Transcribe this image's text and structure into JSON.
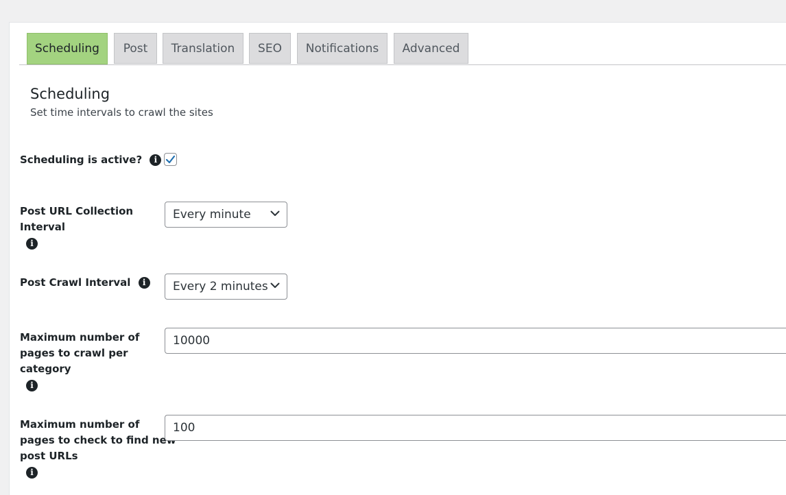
{
  "tabs": [
    {
      "label": "Scheduling",
      "active": true
    },
    {
      "label": "Post",
      "active": false
    },
    {
      "label": "Translation",
      "active": false
    },
    {
      "label": "SEO",
      "active": false
    },
    {
      "label": "Notifications",
      "active": false
    },
    {
      "label": "Advanced",
      "active": false
    }
  ],
  "section": {
    "title": "Scheduling",
    "description": "Set time intervals to crawl the sites"
  },
  "fields": {
    "scheduling_active": {
      "label": "Scheduling is active?",
      "checked": true,
      "icon": "info-icon"
    },
    "url_collection_interval": {
      "label_line1": "Post URL Collection",
      "label_line2": "Interval",
      "value": "Every minute",
      "icon": "info-icon"
    },
    "crawl_interval": {
      "label": "Post Crawl Interval",
      "value": "Every 2 minutes",
      "icon": "info-icon"
    },
    "max_pages_category": {
      "label_line1": "Maximum number of",
      "label_line2": "pages to crawl per",
      "label_line3": "category",
      "value": "10000",
      "icon": "info-icon"
    },
    "max_pages_new_urls": {
      "label_line1": "Maximum number of",
      "label_line2": "pages to check to find new",
      "label_line3": "post URLs",
      "value": "100",
      "icon": "info-icon"
    }
  },
  "colors": {
    "active_tab": "#a3d380",
    "inactive_tab": "#dcdcde",
    "checkbox_check": "#2271b1"
  }
}
